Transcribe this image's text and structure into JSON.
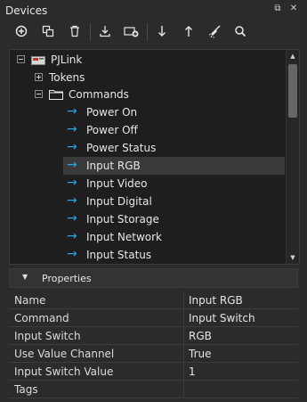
{
  "panel": {
    "title": "Devices"
  },
  "toolbar": {
    "buttons": [
      {
        "icon": "add-icon"
      },
      {
        "icon": "duplicate-icon"
      },
      {
        "icon": "delete-icon"
      },
      {
        "icon": "import-icon"
      },
      {
        "icon": "add-device-icon"
      },
      {
        "icon": "move-down-icon"
      },
      {
        "icon": "move-up-icon"
      },
      {
        "icon": "clean-icon"
      },
      {
        "icon": "search-icon"
      }
    ]
  },
  "tree": {
    "root": "PJLink",
    "tokens": "Tokens",
    "commands": "Commands",
    "items": [
      "Power On",
      "Power Off",
      "Power Status",
      "Input RGB",
      "Input Video",
      "Input Digital",
      "Input Storage",
      "Input Network",
      "Input Status"
    ],
    "selected": "Input RGB",
    "accent": "#29a3e6"
  },
  "properties": {
    "header": "Properties",
    "rows": [
      {
        "name": "Name",
        "value": "Input RGB"
      },
      {
        "name": "Command",
        "value": "Input Switch"
      },
      {
        "name": "Input Switch",
        "value": "RGB"
      },
      {
        "name": "Use Value Channel",
        "value": "True"
      },
      {
        "name": "Input Switch Value",
        "value": "1"
      },
      {
        "name": "Tags",
        "value": ""
      }
    ]
  }
}
